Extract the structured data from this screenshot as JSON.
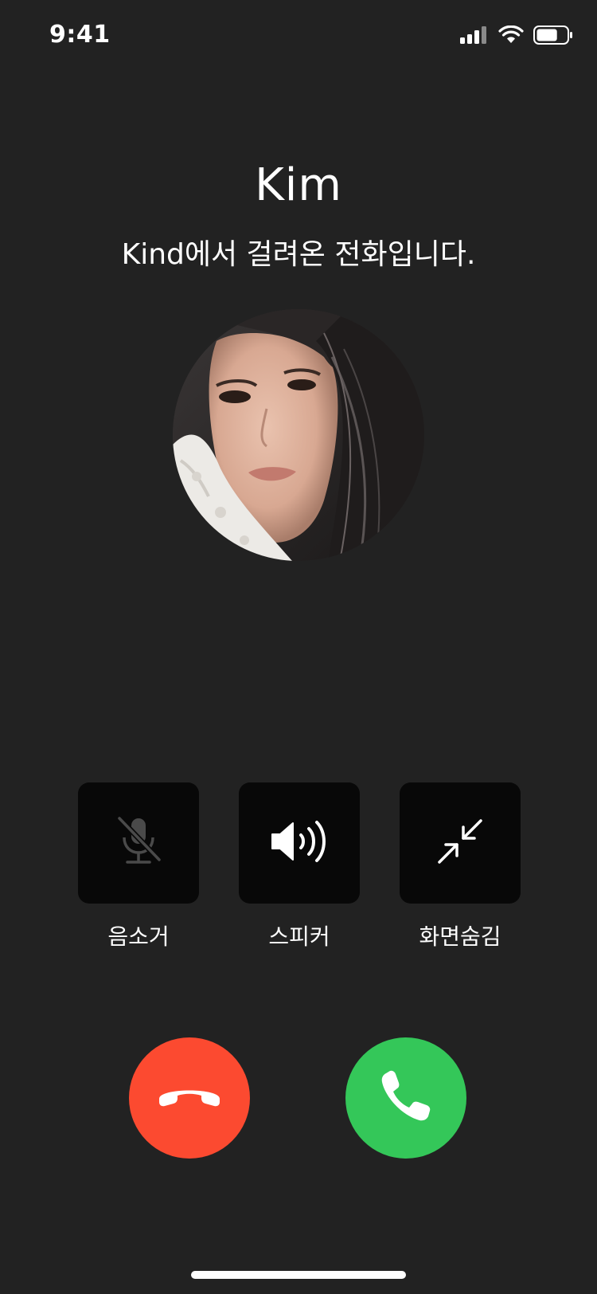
{
  "status_bar": {
    "time": "9:41",
    "icons": [
      "cellular-signal-icon",
      "wifi-icon",
      "battery-icon"
    ],
    "battery_level": 0.7
  },
  "caller": {
    "name": "Kim",
    "subtitle": "Kind에서 걸려온 전화입니다."
  },
  "controls": [
    {
      "label": "음소거",
      "icon": "mic-muted-icon",
      "enabled": false
    },
    {
      "label": "스피커",
      "icon": "speaker-icon",
      "enabled": true
    },
    {
      "label": "화면숨김",
      "icon": "minimize-icon",
      "enabled": true
    }
  ],
  "call_buttons": {
    "decline_icon": "phone-hangup-icon",
    "accept_icon": "phone-icon"
  },
  "colors": {
    "background": "#222222",
    "control_bg": "#080808",
    "decline": "#fc4a30",
    "accept": "#34c759",
    "muted_icon": "#4a4a4a"
  }
}
